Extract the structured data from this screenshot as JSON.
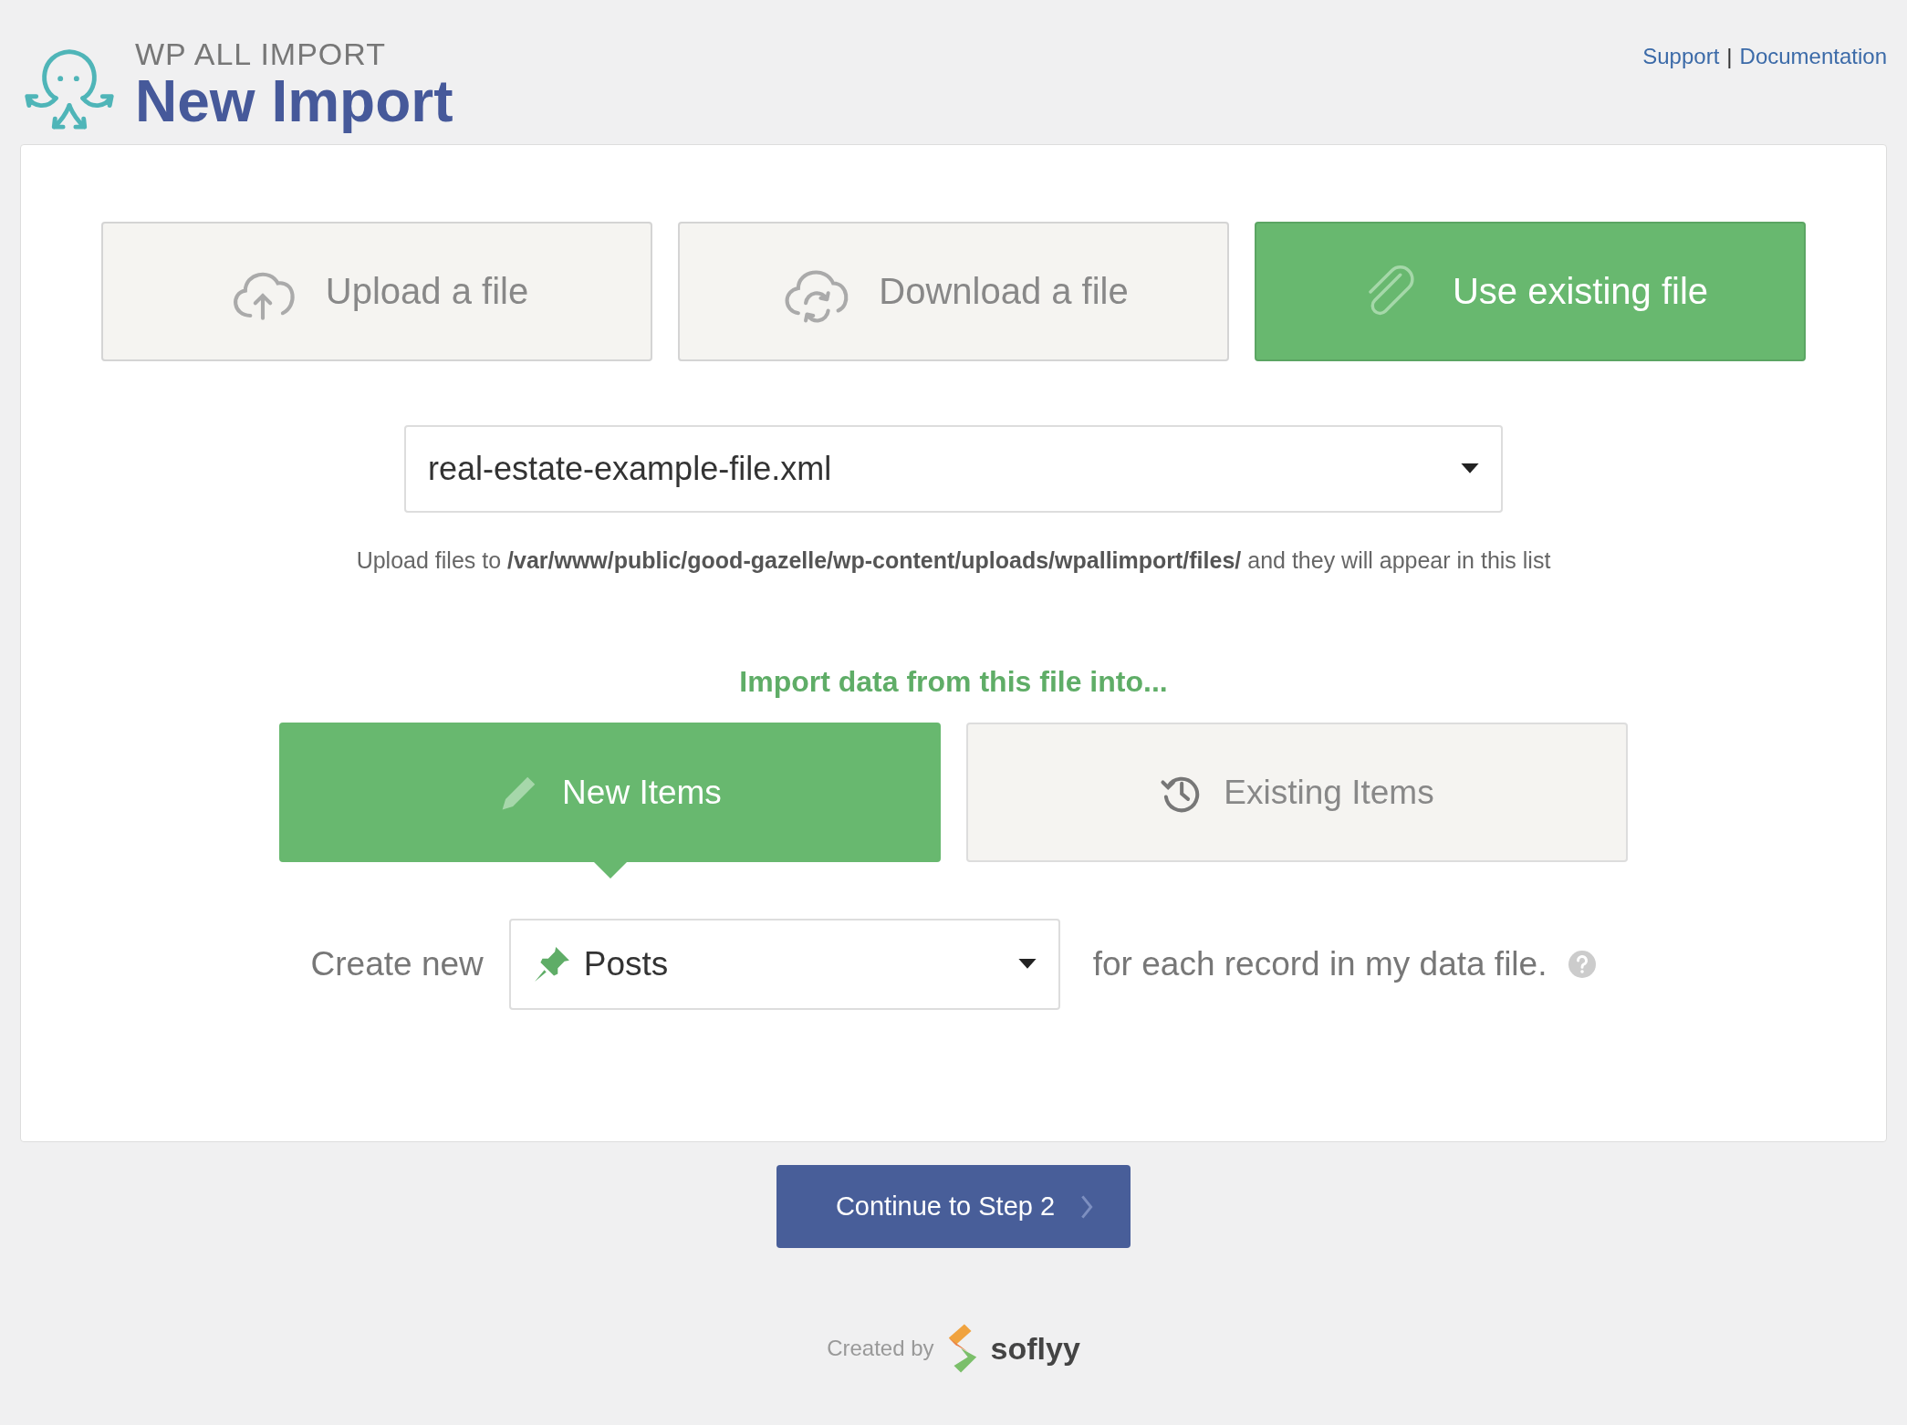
{
  "header": {
    "brand": "WP ALL IMPORT",
    "title": "New Import",
    "links": [
      {
        "label": "Support"
      },
      {
        "label": "Documentation"
      }
    ],
    "separator": "|"
  },
  "source_options": [
    {
      "kind": "upload",
      "label": "Upload a file",
      "selected": false
    },
    {
      "kind": "download",
      "label": "Download a file",
      "selected": false
    },
    {
      "kind": "existing",
      "label": "Use existing file",
      "selected": true
    }
  ],
  "file_select": {
    "value": "real-estate-example-file.xml"
  },
  "hint": "Upload files to **/var/www/public/good-gazelle/wp-content/uploads/wpallimport/files/** and they will appear in this list",
  "import_heading": "Import data from this file into...",
  "modes": [
    {
      "kind": "new",
      "label": "New Items",
      "selected": true
    },
    {
      "kind": "existing",
      "label": "Existing Items",
      "selected": false
    }
  ],
  "create_row": {
    "prefix": "Create new",
    "post_type": "Posts",
    "suffix": "for each record in my data file."
  },
  "continue_button": "Continue to Step 2",
  "footer": {
    "credit": "Created by",
    "brand": "soflyy"
  }
}
